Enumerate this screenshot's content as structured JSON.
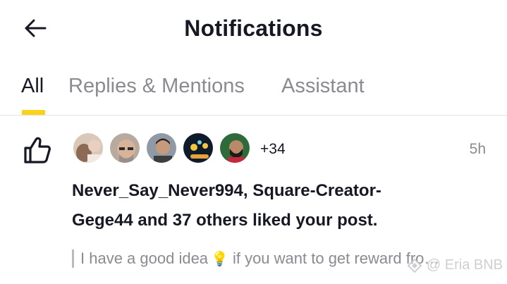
{
  "header": {
    "title": "Notifications",
    "back_icon": "arrow-left-icon"
  },
  "tabs": [
    {
      "label": "All",
      "active": true
    },
    {
      "label": "Replies & Mentions",
      "active": false
    },
    {
      "label": "Assistant",
      "active": false
    }
  ],
  "accent_color": "#fbd21a",
  "notification": {
    "icon": "thumbs-up-icon",
    "avatars": [
      "avatar-1",
      "avatar-2",
      "avatar-3",
      "avatar-4",
      "avatar-5"
    ],
    "more_count": "+34",
    "time": "5h",
    "message": "Never_Say_Never994, Square-Creator-Gege44 and 37 others liked your post.",
    "preview_before": "I have a good idea",
    "preview_emoji": "💡",
    "preview_after": "if you want to get reward fro…"
  },
  "watermark": {
    "text": "@ Eria BNB",
    "icon": "binance-square-logo-icon"
  }
}
